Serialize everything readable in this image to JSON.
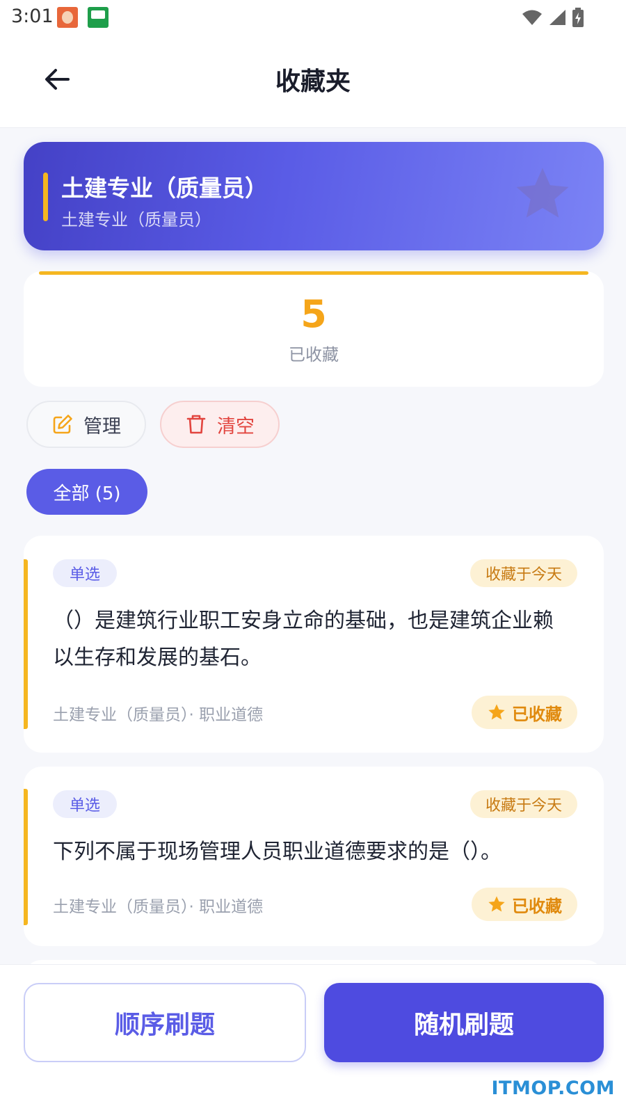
{
  "status_bar": {
    "time": "3:01"
  },
  "header": {
    "title": "收藏夹"
  },
  "banner": {
    "title": "土建专业（质量员）",
    "subtitle": "土建专业（质量员）"
  },
  "summary": {
    "count": "5",
    "label": "已收藏"
  },
  "actions": {
    "manage_label": "管理",
    "clear_label": "清空"
  },
  "filter": {
    "label": "全部 (5)"
  },
  "questions": [
    {
      "type": "单选",
      "saved": "收藏于今天",
      "text": "（）是建筑行业职工安身立命的基础，也是建筑企业赖以生存和发展的基石。",
      "meta": "土建专业（质量员）· 职业道德",
      "fav_label": "已收藏"
    },
    {
      "type": "单选",
      "saved": "收藏于今天",
      "text": "下列不属于现场管理人员职业道德要求的是（）。",
      "meta": "土建专业（质量员）· 职业道德",
      "fav_label": "已收藏"
    }
  ],
  "bottom": {
    "order_label": "顺序刷题",
    "random_label": "随机刷题"
  },
  "watermark": "ITMOP.COM",
  "colors": {
    "primary": "#5a5ce6",
    "accent": "#f5b620",
    "danger": "#e2453f"
  }
}
